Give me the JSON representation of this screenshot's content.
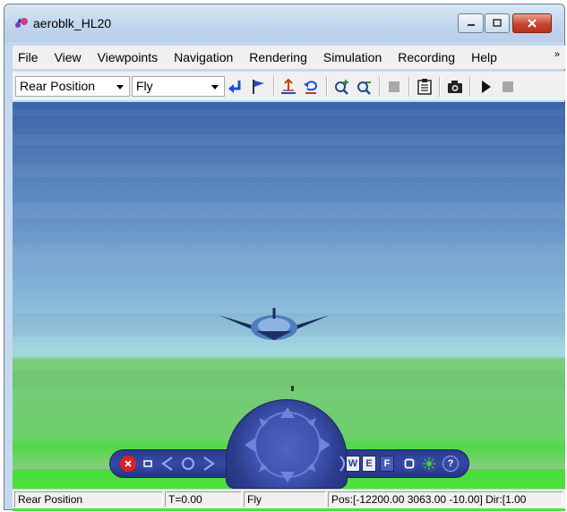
{
  "window": {
    "title": "aeroblk_HL20"
  },
  "menubar": {
    "items": [
      {
        "label": "File"
      },
      {
        "label": "View"
      },
      {
        "label": "Viewpoints"
      },
      {
        "label": "Navigation"
      },
      {
        "label": "Rendering"
      },
      {
        "label": "Simulation"
      },
      {
        "label": "Recording"
      },
      {
        "label": "Help"
      }
    ],
    "overflow": "»"
  },
  "toolbar": {
    "viewpoint_select": "Rear Position",
    "navigation_mode_select": "Fly"
  },
  "navpanel": {
    "w_label": "W",
    "e_label": "E",
    "f_label": "F",
    "help_label": "?"
  },
  "statusbar": {
    "viewpoint": "Rear Position",
    "time": "T=0.00",
    "mode": "Fly",
    "position": "Pos:[-12200.00 3063.00 -10.00] Dir:[1.00"
  },
  "colors": {
    "sky_top": "#3b65a8",
    "horizon": "#a4d9e0",
    "ground": "#4ade3d",
    "nav_panel": "#2a3b8e"
  }
}
